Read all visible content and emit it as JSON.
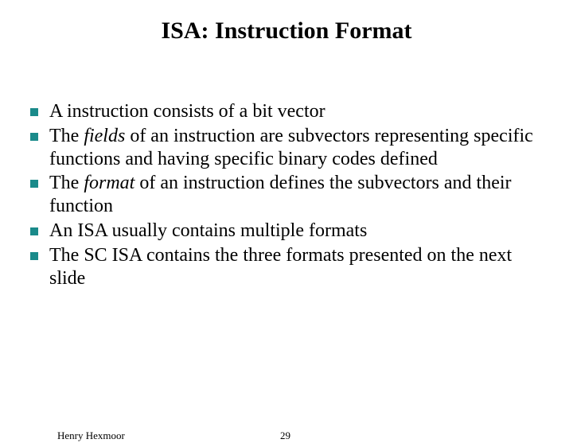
{
  "title": "ISA: Instruction Format",
  "bullets": {
    "b0": "A instruction consists of a bit vector",
    "b1_pre": "The ",
    "b1_em": "fields",
    "b1_post": " of an instruction are subvectors representing specific functions and having specific binary codes defined",
    "b2_pre": "The ",
    "b2_em": "format",
    "b2_post": " of an instruction defines the subvectors and their function",
    "b3": "An ISA usually contains multiple formats",
    "b4": "The SC ISA contains the three formats presented on the next slide"
  },
  "footer": {
    "author": "Henry Hexmoor",
    "page": "29"
  }
}
